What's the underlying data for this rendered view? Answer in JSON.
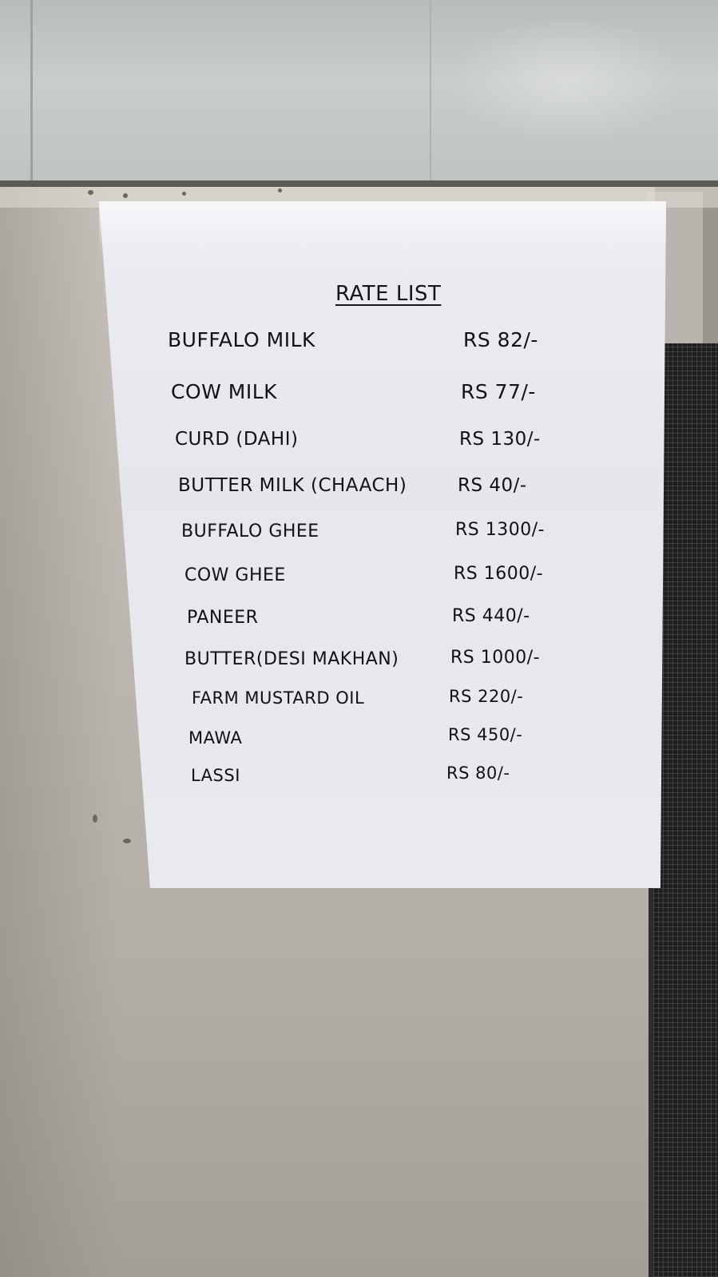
{
  "rate_list": {
    "title": "RATE LIST",
    "items": [
      {
        "name": "BUFFALO MILK",
        "price": "RS 82/-"
      },
      {
        "name": "COW MILK",
        "price": "RS 77/-"
      },
      {
        "name": "CURD (DAHI)",
        "price": "RS 130/-"
      },
      {
        "name": "BUTTER MILK (CHAACH)",
        "price": "RS 40/-"
      },
      {
        "name": "BUFFALO GHEE",
        "price": "RS 1300/-"
      },
      {
        "name": "COW GHEE",
        "price": "RS 1600/-"
      },
      {
        "name": "PANEER",
        "price": "RS 440/-"
      },
      {
        "name": "BUTTER(DESI MAKHAN)",
        "price": "RS 1000/-"
      },
      {
        "name": "FARM MUSTARD OIL",
        "price": "RS 220/-"
      },
      {
        "name": "MAWA",
        "price": "RS 450/-"
      },
      {
        "name": "LASSI",
        "price": "RS 80/-"
      }
    ]
  }
}
